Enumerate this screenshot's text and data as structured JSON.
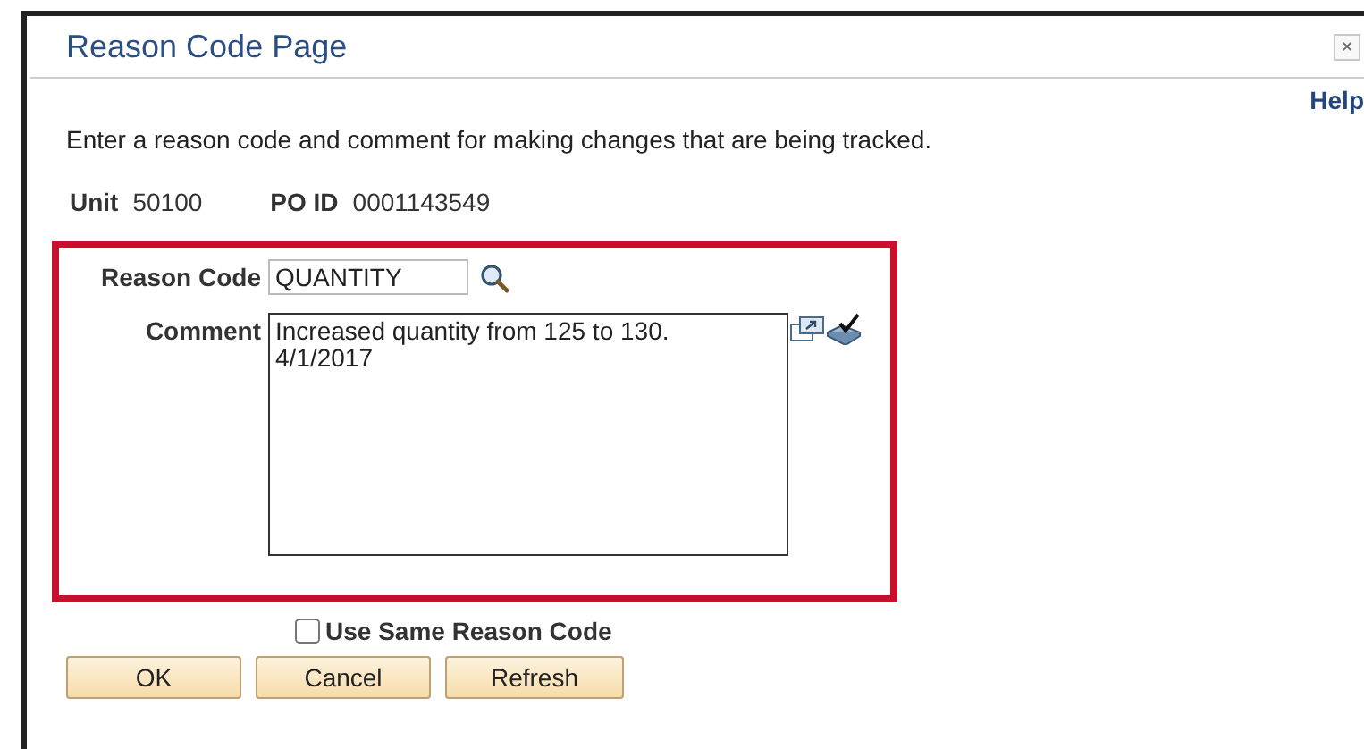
{
  "window": {
    "title": "Reason Code Page",
    "close": "×"
  },
  "help_link": "Help",
  "instructions": "Enter a reason code and comment for making changes that are being tracked.",
  "info": [
    {
      "label": "Unit",
      "value": "50100"
    },
    {
      "label": "PO ID",
      "value": "0001143549"
    }
  ],
  "form": {
    "highlighted": true,
    "reason_code": {
      "label": "Reason Code",
      "value": "QUANTITY"
    },
    "comment": {
      "label": "Comment",
      "value": "Increased quantity from 125 to 130.\n4/1/2017"
    }
  },
  "use_same_reason_code": {
    "label": "Use Same Reason Code",
    "checked": false
  },
  "buttons": [
    "OK",
    "Cancel",
    "Refresh"
  ]
}
